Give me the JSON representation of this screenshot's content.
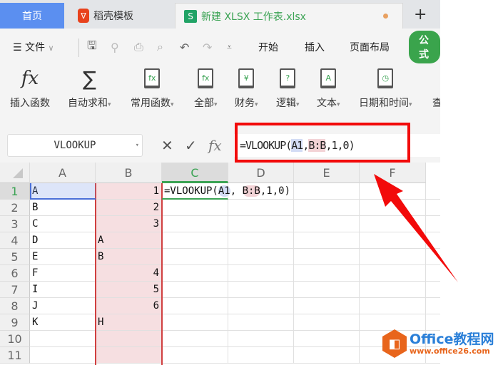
{
  "tabs": {
    "home": "首页",
    "template": "稻壳模板",
    "file": "新建 XLSX 工作表.xlsx",
    "new_tab": "+"
  },
  "menu": {
    "file": "文件",
    "items": [
      "开始",
      "插入",
      "页面布局",
      "公式"
    ]
  },
  "ribbon": [
    {
      "label": "插入函数",
      "icon": "fx-icon",
      "glyph": "fx"
    },
    {
      "label": "自动求和",
      "icon": "sigma-icon",
      "glyph": "∑"
    },
    {
      "label": "常用函数",
      "icon": "fx-star-book-icon",
      "glyph": "fx"
    },
    {
      "label": "全部",
      "icon": "fx-book-icon",
      "glyph": "fx"
    },
    {
      "label": "财务",
      "icon": "yen-book-icon",
      "glyph": "¥"
    },
    {
      "label": "逻辑",
      "icon": "question-book-icon",
      "glyph": "?"
    },
    {
      "label": "文本",
      "icon": "text-book-icon",
      "glyph": "A"
    },
    {
      "label": "日期和时间",
      "icon": "clock-book-icon",
      "glyph": "◷"
    },
    {
      "label": "查",
      "icon": "lookup-icon",
      "glyph": ""
    }
  ],
  "formula_bar": {
    "name_box": "VLOOKUP",
    "fx": "fx",
    "formula_prefix": "=VLOOKUP(",
    "arg1": "A1",
    "sep1": ",",
    "arg2": "B:B",
    "formula_suffix": ",1,0)"
  },
  "columns": [
    "A",
    "B",
    "C",
    "D",
    "E",
    "F"
  ],
  "rows": [
    {
      "n": "1",
      "a": "A",
      "b": "1"
    },
    {
      "n": "2",
      "a": "B",
      "b": "2"
    },
    {
      "n": "3",
      "a": "C",
      "b": "3"
    },
    {
      "n": "4",
      "a": "D",
      "b": "A"
    },
    {
      "n": "5",
      "a": "E",
      "b": "B"
    },
    {
      "n": "6",
      "a": "F",
      "b": "4"
    },
    {
      "n": "7",
      "a": "I",
      "b": "5"
    },
    {
      "n": "8",
      "a": "J",
      "b": "6"
    },
    {
      "n": "9",
      "a": "K",
      "b": "H"
    },
    {
      "n": "10",
      "a": "",
      "b": ""
    },
    {
      "n": "11",
      "a": "",
      "b": ""
    }
  ],
  "c1": {
    "prefix": "=VLOOKUP(",
    "arg1": "A1",
    "sep": ", ",
    "arg2": "B:B",
    "suffix": ",1,0)"
  },
  "watermark": {
    "title": "Office教程网",
    "url": "www.office26.com"
  },
  "colors": {
    "accent": "#3ba354",
    "annotation": "#f20a0a"
  }
}
